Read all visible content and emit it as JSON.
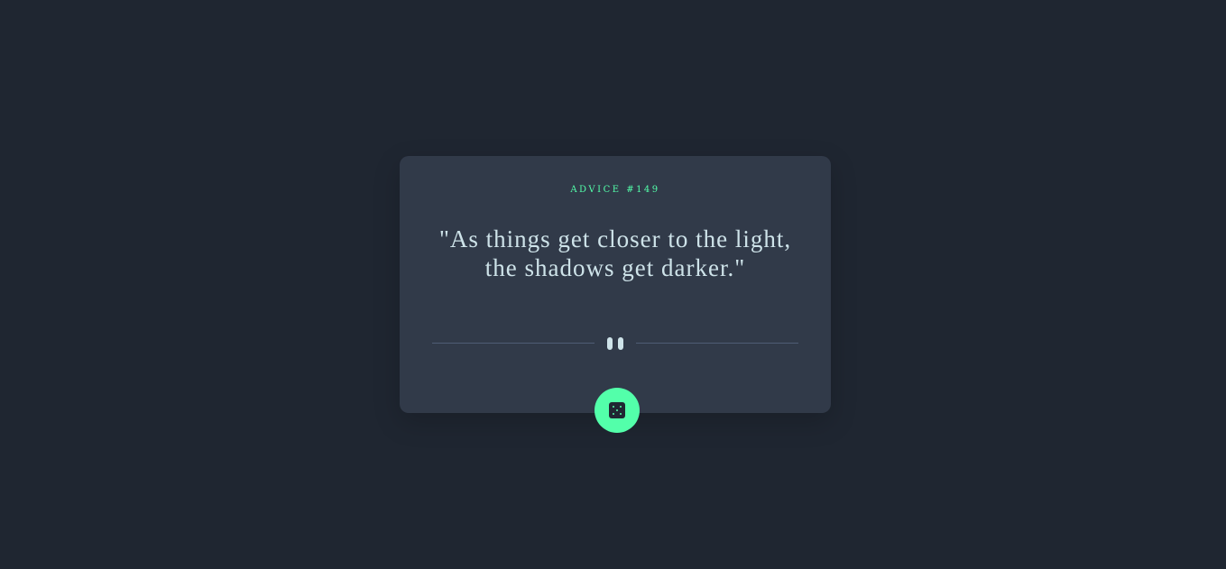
{
  "card": {
    "advice_label": "ADVICE #149",
    "quote": "\"As things get closer to the light, the shadows get darker.\""
  },
  "divider": {
    "icon": "pause-icon"
  },
  "button": {
    "icon": "dice-icon",
    "aria_label": "Get new advice"
  },
  "colors": {
    "background": "#1f2631",
    "card": "#313a49",
    "accent": "#53ffaa",
    "text": "#cee3e9",
    "divider": "#4f5d74"
  }
}
